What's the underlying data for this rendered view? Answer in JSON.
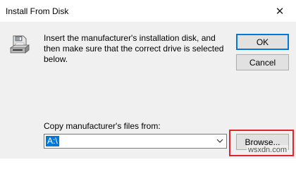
{
  "window": {
    "title": "Install From Disk",
    "close_glyph": "✕"
  },
  "message": "Insert the manufacturer's installation disk, and then make sure that the correct drive is selected below.",
  "buttons": {
    "ok": "OK",
    "cancel": "Cancel",
    "browse": "Browse..."
  },
  "copy_from": {
    "label": "Copy manufacturer's files from:",
    "value": "A:\\"
  },
  "icons": {
    "disk": "floppy-drive-icon",
    "dropdown": "chevron-down-icon"
  },
  "colors": {
    "accent": "#0078d7",
    "highlight": "#e0242f"
  },
  "watermark": "wsxdn.com"
}
